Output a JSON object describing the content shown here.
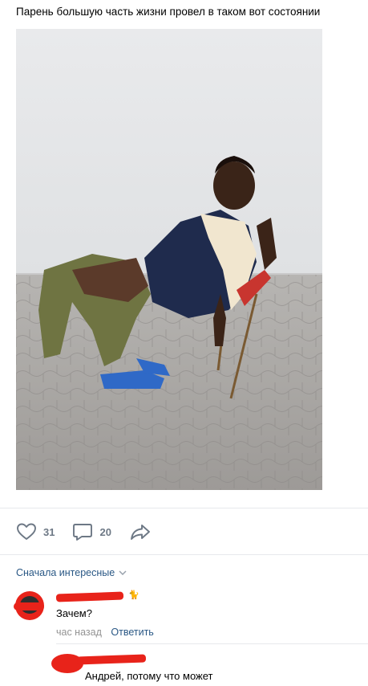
{
  "post": {
    "text": "Парень большую часть жизни провел в таком вот состоянии"
  },
  "actions": {
    "likes": "31",
    "comments": "20",
    "like_icon": "heart-icon",
    "comment_icon": "comment-bubble-icon",
    "share_icon": "share-arrow-icon"
  },
  "comments_section": {
    "sort_label": "Сначала интересные",
    "sort_icon": "chevron-down-icon",
    "items": [
      {
        "text": "Зачем?",
        "time": "час назад",
        "reply_label": "Ответить",
        "emoji": "🐈"
      },
      {
        "text": "Андрей, потому что может"
      }
    ]
  },
  "colors": {
    "link": "#2a5885",
    "icon": "#6d7885",
    "muted": "#939393",
    "divider": "#e7e8ec",
    "redaction": "#e8231a"
  }
}
